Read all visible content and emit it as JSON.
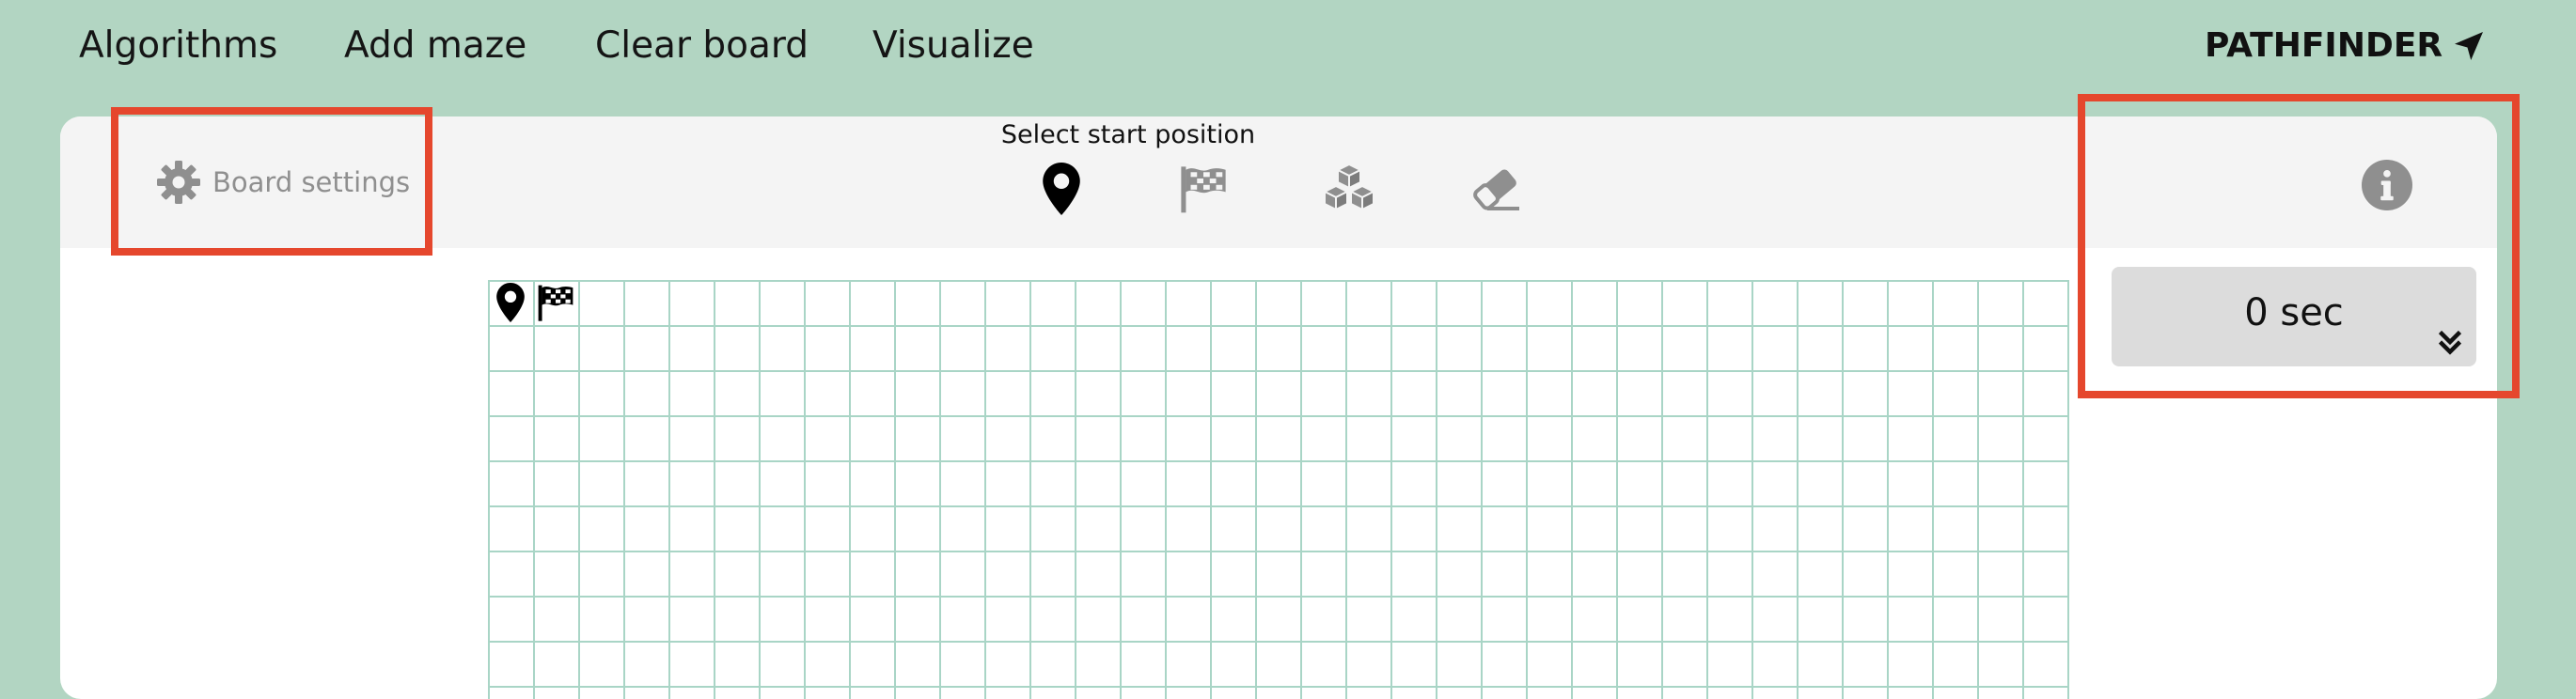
{
  "nav": {
    "items": [
      {
        "label": "Algorithms"
      },
      {
        "label": "Add maze"
      },
      {
        "label": "Clear board"
      },
      {
        "label": "Visualize"
      }
    ],
    "brand": "PATHFINDER",
    "brand_icon": "send-arrow-icon"
  },
  "toolbar": {
    "settings_label": "Board settings",
    "settings_icon": "gear-icon",
    "mode_label": "Select start position",
    "tools": [
      {
        "name": "start-marker",
        "icon": "map-marker-icon",
        "active": true
      },
      {
        "name": "target-flag",
        "icon": "checkered-flag-icon",
        "active": false
      },
      {
        "name": "walls",
        "icon": "cubes-icon",
        "active": false
      },
      {
        "name": "eraser",
        "icon": "eraser-icon",
        "active": false
      }
    ],
    "info_icon": "info-icon"
  },
  "grid": {
    "columns": 35,
    "rows": 10,
    "start_node": {
      "row": 0,
      "col": 0
    },
    "target_node": {
      "row": 0,
      "col": 1
    }
  },
  "timer": {
    "value": "0 sec",
    "expand_icon": "chevrons-down-icon"
  },
  "colors": {
    "page_background": "#b2d5c2",
    "grid_line": "#a9d5c6",
    "toolbar_background": "#f4f4f4",
    "timer_background": "#dcdcdc",
    "highlight": "#e5472d"
  }
}
